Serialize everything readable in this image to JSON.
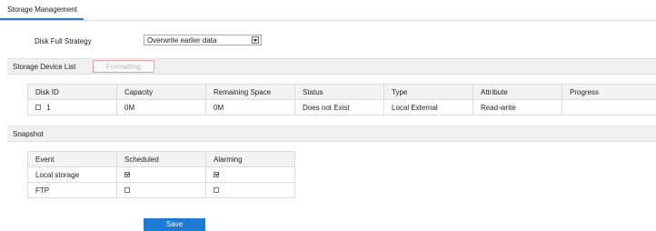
{
  "tab": {
    "label": "Storage Management"
  },
  "disk_full": {
    "label": "Disk Full Strategy",
    "value": "Overwrite earlier data"
  },
  "storage_list": {
    "title": "Storage Device List",
    "format_label": "Formatting",
    "headers": [
      "Disk ID",
      "Capacity",
      "Remaining Space",
      "Status",
      "Type",
      "Attribute",
      "Progress"
    ],
    "rows": [
      {
        "disk_id": "1",
        "capacity": "0M",
        "remaining": "0M",
        "status": "Does not Exist",
        "type": "Local External",
        "attribute": "Read-write",
        "progress": ""
      }
    ]
  },
  "snapshot": {
    "title": "Snapshot",
    "headers": [
      "Event",
      "Scheduled",
      "Alarming"
    ],
    "rows": [
      {
        "event": "Local storage",
        "scheduled": true,
        "alarming": true
      },
      {
        "event": "FTP",
        "scheduled": false,
        "alarming": false
      }
    ]
  },
  "save_label": "Save",
  "colors": {
    "accent": "#1f7ad6",
    "format_border": "#e8a0a0"
  }
}
